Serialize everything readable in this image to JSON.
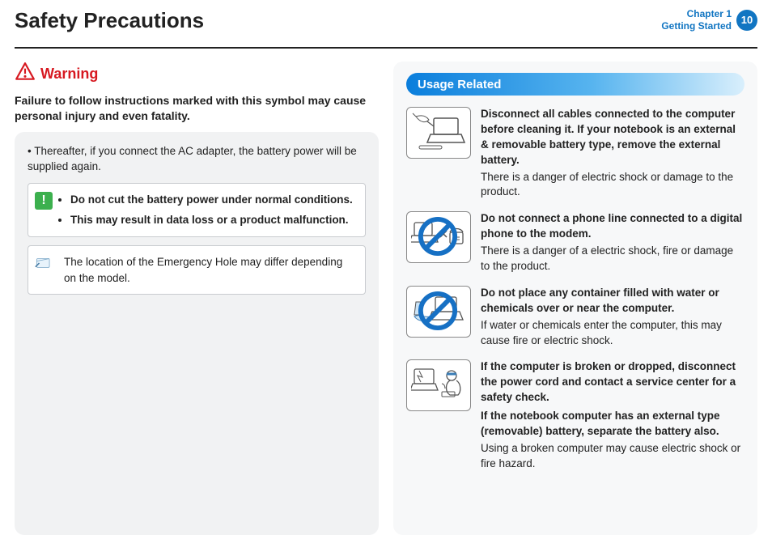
{
  "header": {
    "title": "Safety Precautions",
    "chapter_line1": "Chapter 1",
    "chapter_line2": "Getting Started",
    "page_number": "10"
  },
  "left": {
    "warning_label": "Warning",
    "warning_lead": "Failure to follow instructions marked with this symbol may cause personal injury and even fatality.",
    "bullet_ac": "Thereafter, if you connect the AC adapter, the battery power will be supplied again.",
    "alert_li1": "Do not cut the battery power under normal conditions.",
    "alert_li2": "This may result in data loss or a product malfunction.",
    "note_text": "The location of the Emergency Hole may differ depending on the model."
  },
  "right": {
    "section_title": "Usage Related",
    "items": [
      {
        "bold": "Disconnect all cables connected to the computer before cleaning it. If your notebook is an external & removable battery type, remove the external battery.",
        "body": "There is a danger of electric shock or damage to the product."
      },
      {
        "bold": "Do not connect a phone line connected to a digital phone to the modem.",
        "body": "There is a danger of a electric shock, fire or damage to the product."
      },
      {
        "bold": "Do not place any container filled with water or chemicals over or near the computer.",
        "body": "If water or chemicals enter the computer, this may cause fire or electric shock."
      },
      {
        "bold": "If the computer is broken or dropped, disconnect the power cord and contact a service center for a safety check.",
        "bold2": "If the notebook computer has an external type (removable) battery, separate the battery also.",
        "body": "Using a broken computer may cause electric shock or fire hazard."
      }
    ]
  }
}
